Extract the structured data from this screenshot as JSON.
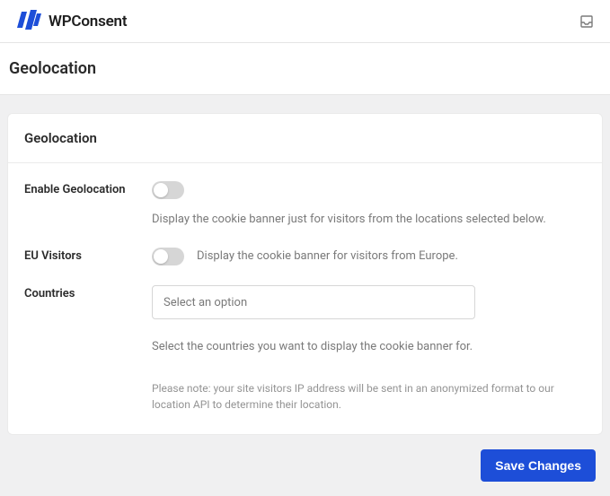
{
  "brand": {
    "name": "WPConsent"
  },
  "page": {
    "title": "Geolocation"
  },
  "card": {
    "title": "Geolocation",
    "rows": {
      "enable": {
        "label": "Enable Geolocation",
        "desc": "Display the cookie banner just for visitors from the locations selected below."
      },
      "eu": {
        "label": "EU Visitors",
        "desc": "Display the cookie banner for visitors from Europe."
      },
      "countries": {
        "label": "Countries",
        "placeholder": "Select an option",
        "helper": "Select the countries you want to display the cookie banner for."
      }
    },
    "note": "Please note: your site visitors IP address will be sent in an anonymized format to our location API to determine their location."
  },
  "buttons": {
    "save": "Save Changes"
  }
}
